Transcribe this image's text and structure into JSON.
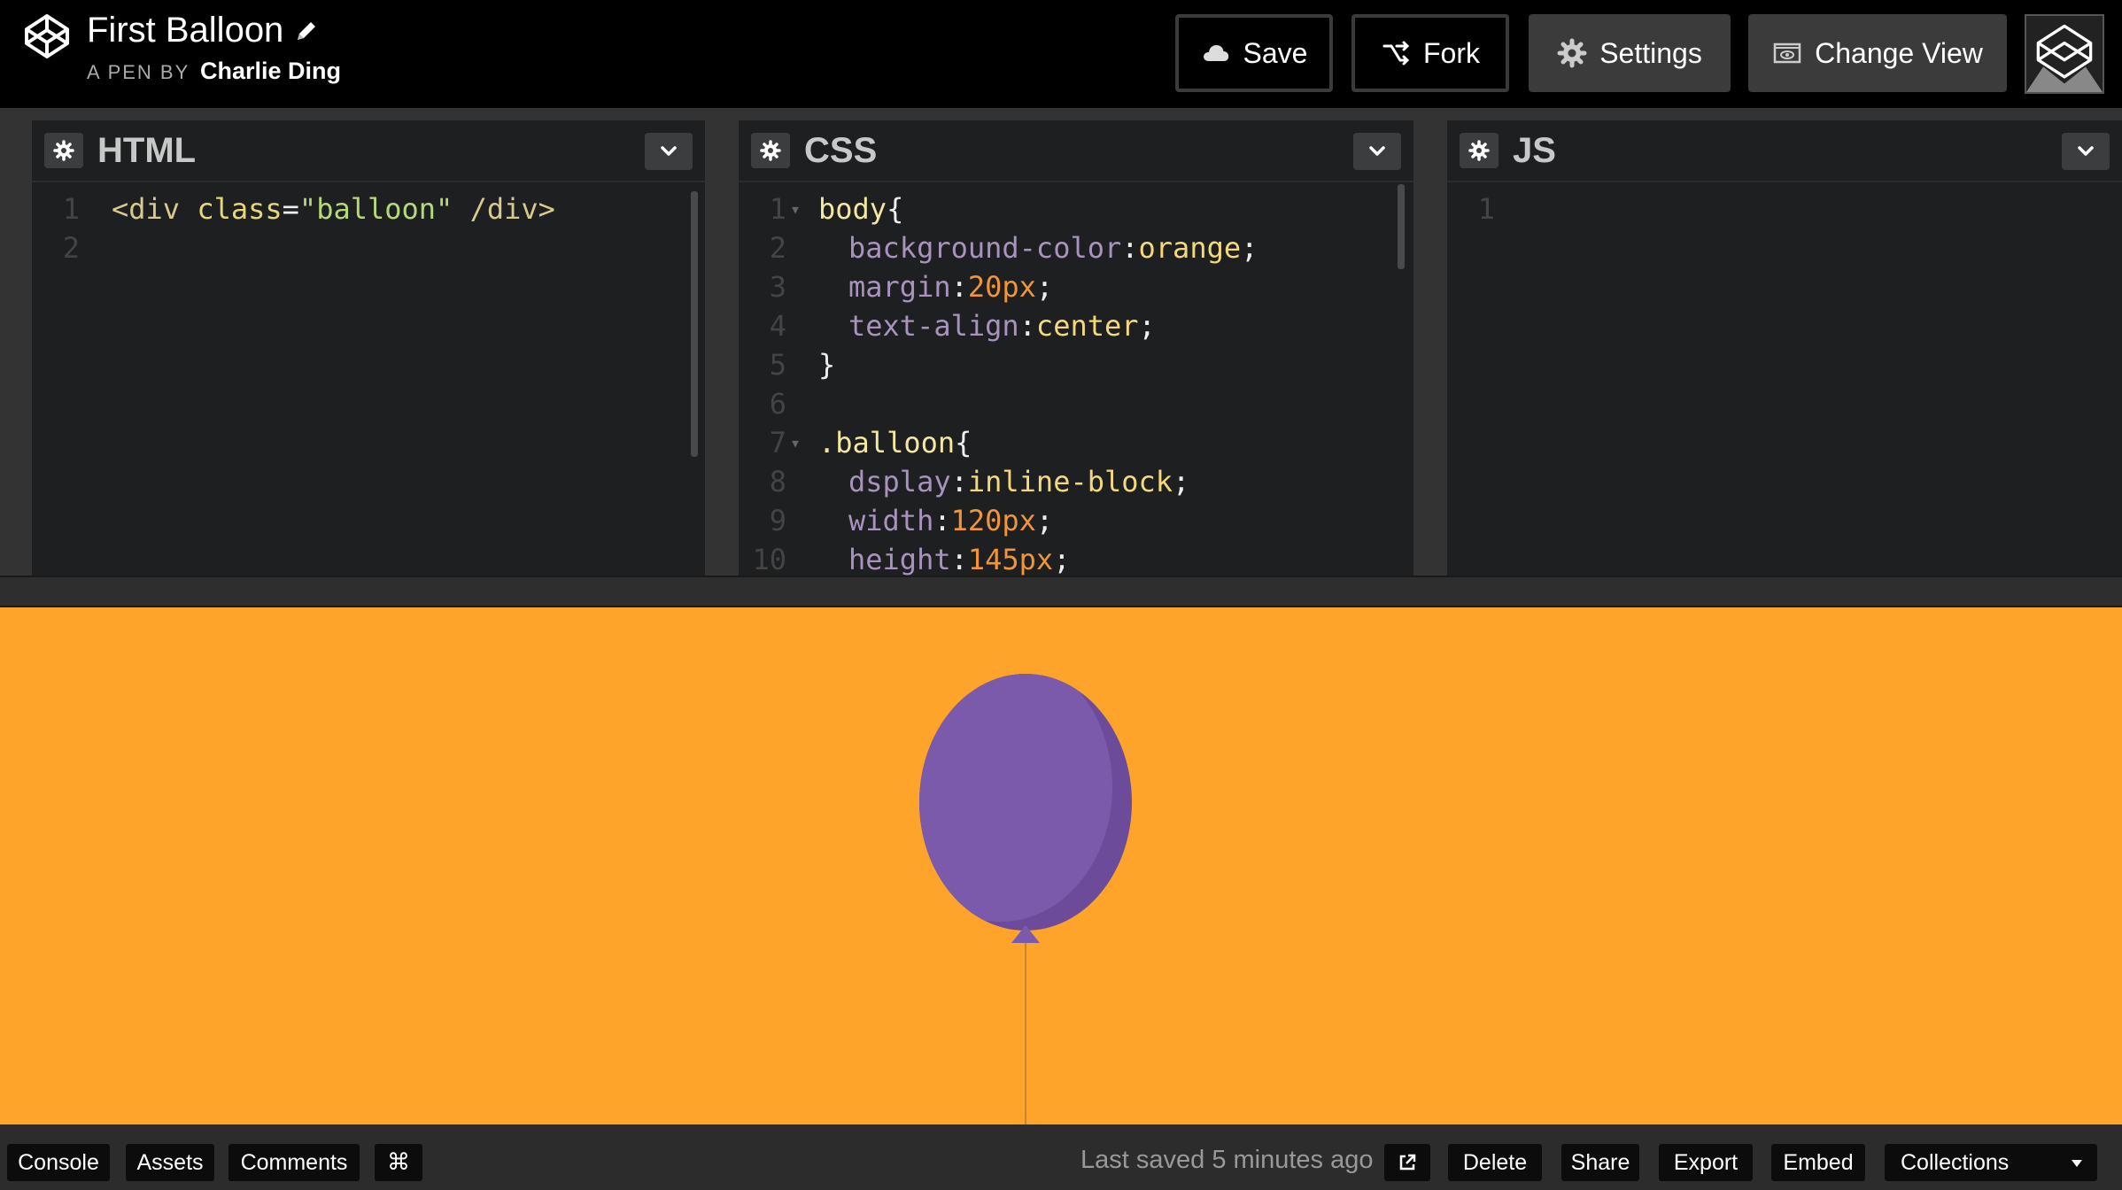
{
  "header": {
    "pen_title": "First Balloon",
    "pen_by_label": "A PEN BY",
    "author": "Charlie Ding",
    "buttons": {
      "save": "Save",
      "fork": "Fork",
      "settings": "Settings",
      "change_view": "Change View"
    }
  },
  "editors": {
    "html": {
      "title": "HTML",
      "lines": [
        {
          "n": "1",
          "tokens": [
            [
              "t-tag",
              "<div "
            ],
            [
              "t-attr",
              "class"
            ],
            [
              "t-punc",
              "="
            ],
            [
              "t-str",
              "\"balloon\""
            ],
            [
              "t-tag",
              " /div>"
            ]
          ]
        },
        {
          "n": "2",
          "tokens": []
        }
      ]
    },
    "css": {
      "title": "CSS",
      "lines": [
        {
          "n": "1",
          "fold": true,
          "indent": 0,
          "tokens": [
            [
              "t-sel",
              "body"
            ],
            [
              "t-punc",
              "{"
            ]
          ]
        },
        {
          "n": "2",
          "indent": 1,
          "tokens": [
            [
              "t-prop",
              "background-color"
            ],
            [
              "t-punc",
              ":"
            ],
            [
              "t-val",
              "orange"
            ],
            [
              "t-punc",
              ";"
            ]
          ]
        },
        {
          "n": "3",
          "indent": 1,
          "tokens": [
            [
              "t-prop",
              "margin"
            ],
            [
              "t-punc",
              ":"
            ],
            [
              "t-num",
              "20px"
            ],
            [
              "t-punc",
              ";"
            ]
          ]
        },
        {
          "n": "4",
          "indent": 1,
          "tokens": [
            [
              "t-prop",
              "text-align"
            ],
            [
              "t-punc",
              ":"
            ],
            [
              "t-val",
              "center"
            ],
            [
              "t-punc",
              ";"
            ]
          ]
        },
        {
          "n": "5",
          "indent": 0,
          "tokens": [
            [
              "t-punc",
              "}"
            ]
          ]
        },
        {
          "n": "6",
          "indent": 0,
          "tokens": []
        },
        {
          "n": "7",
          "fold": true,
          "indent": 0,
          "tokens": [
            [
              "t-sel",
              ".balloon"
            ],
            [
              "t-punc",
              "{"
            ]
          ]
        },
        {
          "n": "8",
          "indent": 1,
          "tokens": [
            [
              "t-prop",
              "dsplay"
            ],
            [
              "t-punc",
              ":"
            ],
            [
              "t-val",
              "inline-block"
            ],
            [
              "t-punc",
              ";"
            ]
          ]
        },
        {
          "n": "9",
          "indent": 1,
          "tokens": [
            [
              "t-prop",
              "width"
            ],
            [
              "t-punc",
              ":"
            ],
            [
              "t-num",
              "120px"
            ],
            [
              "t-punc",
              ";"
            ]
          ]
        },
        {
          "n": "10",
          "indent": 1,
          "tokens": [
            [
              "t-prop",
              "height"
            ],
            [
              "t-punc",
              ":"
            ],
            [
              "t-num",
              "145px"
            ],
            [
              "t-punc",
              ";"
            ]
          ]
        }
      ]
    },
    "js": {
      "title": "JS",
      "lines": [
        {
          "n": "1",
          "tokens": []
        }
      ]
    }
  },
  "preview": {
    "background": "#ffa42b",
    "balloon_color": "#7b5aab",
    "balloon_shade": "#6c4c9a"
  },
  "footer": {
    "console": "Console",
    "assets": "Assets",
    "comments": "Comments",
    "last_saved": "Last saved 5 minutes ago",
    "delete": "Delete",
    "share": "Share",
    "export": "Export",
    "embed": "Embed",
    "collections": "Collections"
  },
  "icons": {
    "logo": "codepen-logo-icon",
    "edit": "pencil-icon",
    "save": "cloud-icon",
    "fork": "fork-icon",
    "settings": "gear-icon",
    "change_view": "change-view-icon",
    "keyboard": "command-key-icon",
    "external": "external-link-icon"
  }
}
